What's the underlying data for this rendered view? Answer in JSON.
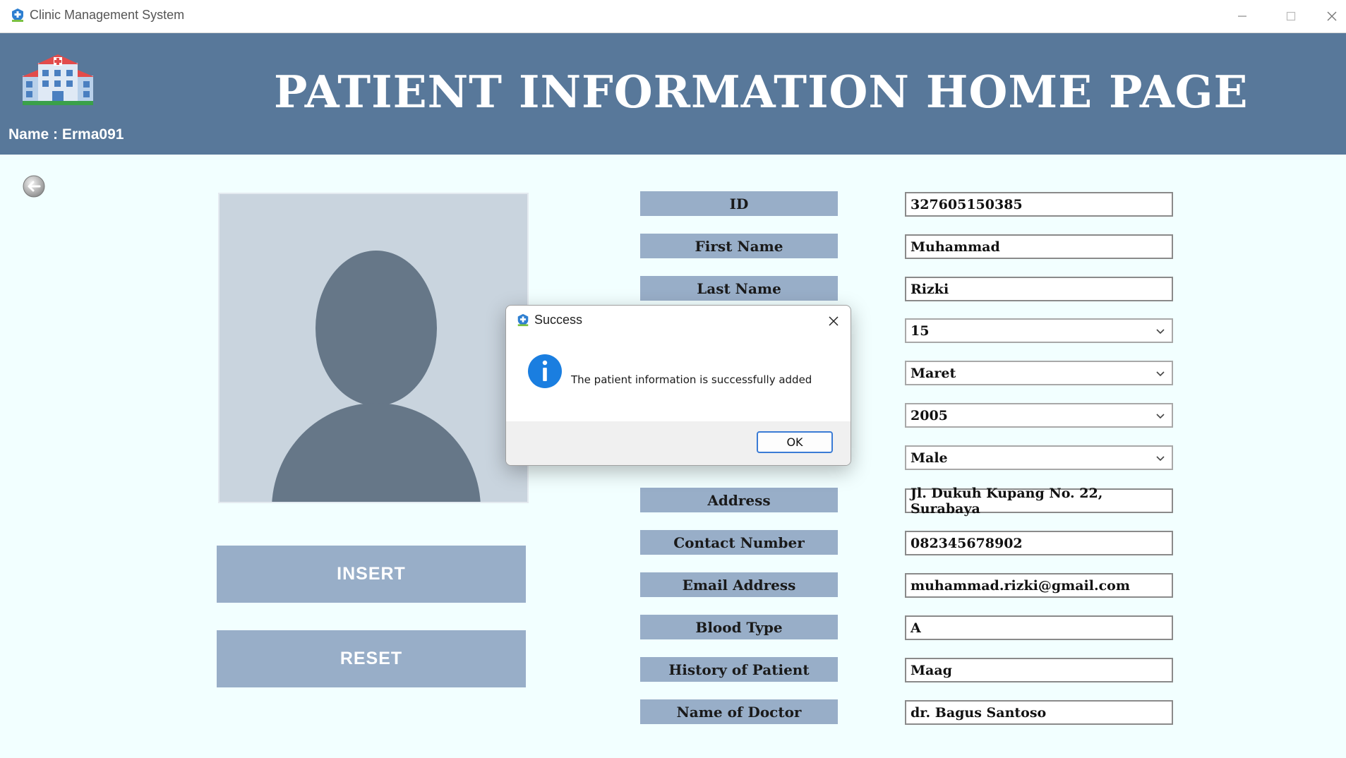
{
  "window": {
    "title": "Clinic Management System"
  },
  "header": {
    "title": "PATIENT INFORMATION HOME PAGE",
    "user_label": "Name : Erma091"
  },
  "actions": {
    "insert": "INSERT",
    "reset": "RESET"
  },
  "form": {
    "labels": [
      "ID",
      "First Name",
      "Last Name",
      "Address",
      "Contact Number",
      "Email Address",
      "Blood Type",
      "History of Patient",
      "Name of Doctor"
    ],
    "id": "327605150385",
    "first_name": "Muhammad",
    "last_name": "Rizki",
    "birth_day": "15",
    "birth_month": "Maret",
    "birth_year": "2005",
    "gender": "Male",
    "address": "Jl. Dukuh Kupang No. 22, Surabaya",
    "contact_number": "082345678902",
    "email": "muhammad.rizki@gmail.com",
    "blood_type": "A",
    "history": "Maag",
    "doctor": "dr. Bagus Santoso"
  },
  "dialog": {
    "title": "Success",
    "message": "The patient information is successfully added",
    "ok_label": "OK"
  },
  "colors": {
    "header": "#58789a",
    "label_bg": "#98aec8",
    "page_bg": "#f2ffff",
    "accent": "#3a7bd5"
  }
}
